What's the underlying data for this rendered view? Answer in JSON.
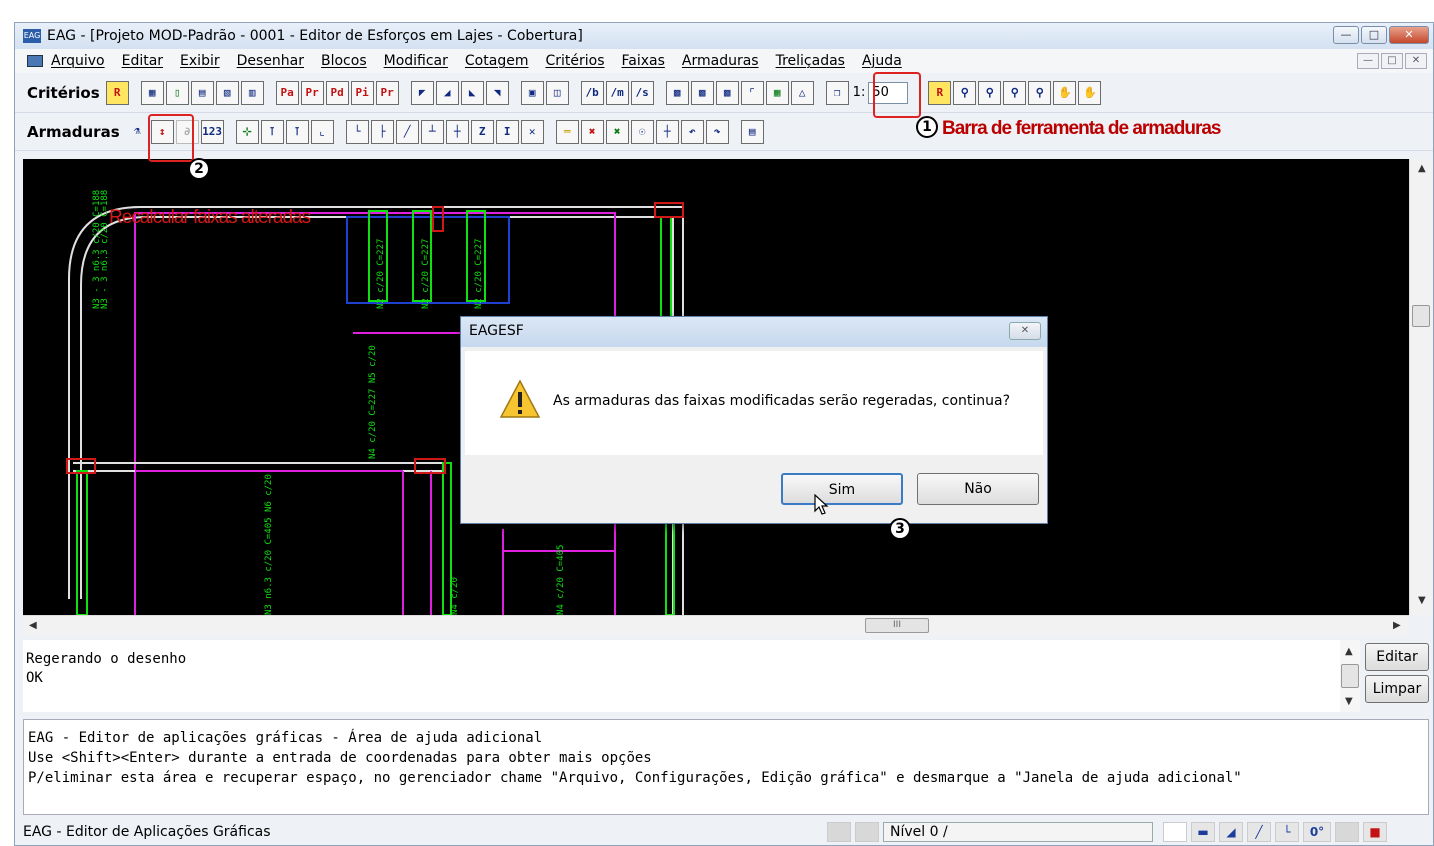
{
  "window": {
    "title": "EAG - [Projeto MOD-Padrão - 0001 - Editor de Esforços em Lajes - Cobertura]",
    "icon_label": "EAG"
  },
  "menubar": {
    "items": [
      "Arquivo",
      "Editar",
      "Exibir",
      "Desenhar",
      "Blocos",
      "Modificar",
      "Cotagem",
      "Critérios",
      "Faixas",
      "Armaduras",
      "Treliçadas",
      "Ajuda"
    ]
  },
  "toolbar1": {
    "label": "Critérios",
    "buttons": [
      "R",
      "Pa",
      "Pr",
      "Pd",
      "Pi",
      "Pr",
      "/b",
      "/m",
      "/s",
      "R"
    ],
    "scale_prefix": "1:",
    "scale_value": "50"
  },
  "toolbar2": {
    "label": "Armaduras",
    "buttons": [
      "123"
    ]
  },
  "annotations": {
    "callout1": "Barra de ferramenta de armaduras",
    "callout2": "Recalcular faixas alteradas",
    "num1": "1",
    "num2": "2",
    "num3": "3"
  },
  "dialog": {
    "title": "EAGESF",
    "message": "As armaduras das faixas modificadas serão regeradas, continua?",
    "yes": "Sim",
    "no": "Não"
  },
  "command": {
    "text": "Regerando o desenho\nOK",
    "edit_button": "Editar",
    "clear_button": "Limpar"
  },
  "help": {
    "text": "EAG - Editor de aplicações gráficas - Área de ajuda adicional\nUse <Shift><Enter> durante a entrada de coordenadas para obter mais opções\nP/eliminar esta área e recuperar espaço, no gerenciador chame \"Arquivo, Configurações, Edição gráfica\" e desmarque a \"Janela de ajuda adicional\""
  },
  "status": {
    "left": "EAG - Editor de Aplicações Gráficas",
    "level": "Nível 0 /",
    "angle": "0°"
  },
  "scroll": {
    "h_thumb": "III"
  },
  "colors": {
    "magenta": "#e020e0",
    "green": "#10e010",
    "white": "#e0e0e0",
    "red": "#d01818",
    "blue": "#2040d0"
  }
}
